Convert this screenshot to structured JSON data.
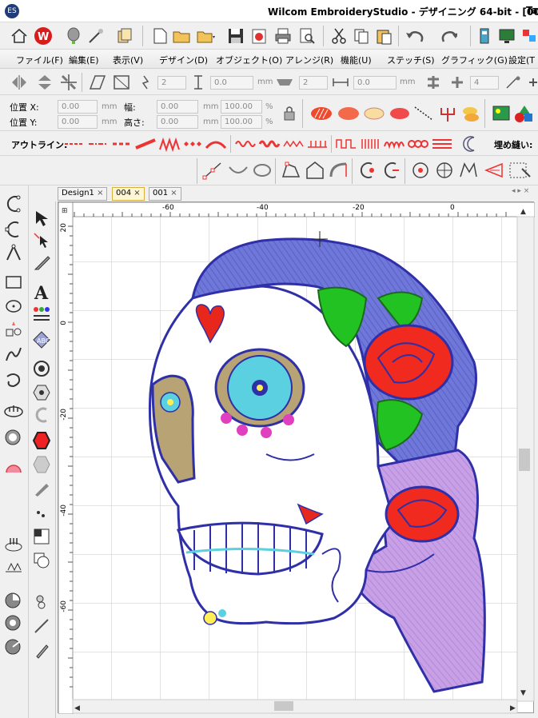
{
  "window": {
    "title": "Wilcom EmbroideryStudio - デザイニング 64-bit - [004",
    "title_overflow": "Ta"
  },
  "menu": [
    "ファイル(F)",
    "編集(E)",
    "表示(V)",
    "デザイン(D)",
    "オブジェクト(O)",
    "アレンジ(R)",
    "機能(U)",
    "ステッチ(S)",
    "グラフィック(G)",
    "設定(T"
  ],
  "toolbar3": {
    "spin1": "2",
    "spin2": "0.0",
    "unit1": "mm",
    "spin3": "2",
    "spin4": "0.0",
    "unit2": "mm",
    "spin5": "4"
  },
  "position": {
    "x_label": "位置 X:",
    "y_label": "位置 Y:",
    "x_value": "0.00",
    "y_value": "0.00",
    "width_label": "幅:",
    "height_label": "高さ:",
    "width_value": "0.00",
    "height_value": "0.00",
    "unit": "mm",
    "scale_w": "100.00",
    "scale_h": "100.00",
    "percent": "%"
  },
  "outline": {
    "label": "アウトライン:",
    "fill_label": "埋め縫い:"
  },
  "tabs": [
    {
      "label": "Design1",
      "active": false
    },
    {
      "label": "004",
      "active": true
    },
    {
      "label": "001",
      "active": false
    }
  ],
  "ruler": {
    "top_labels": [
      "-60",
      "-40",
      "-20",
      "0"
    ],
    "left_labels": [
      "20",
      "0",
      "-20",
      "-40",
      "-60"
    ]
  },
  "colors": {
    "headscarf": "#6f78d8",
    "outline": "#2f2fa8",
    "rose": "#f02a1e",
    "leaf": "#22c222",
    "flower": "#5ad0e0",
    "eye_tan": "#b7a374",
    "hair": "#c8a0e6",
    "heart": "#e8271c"
  }
}
